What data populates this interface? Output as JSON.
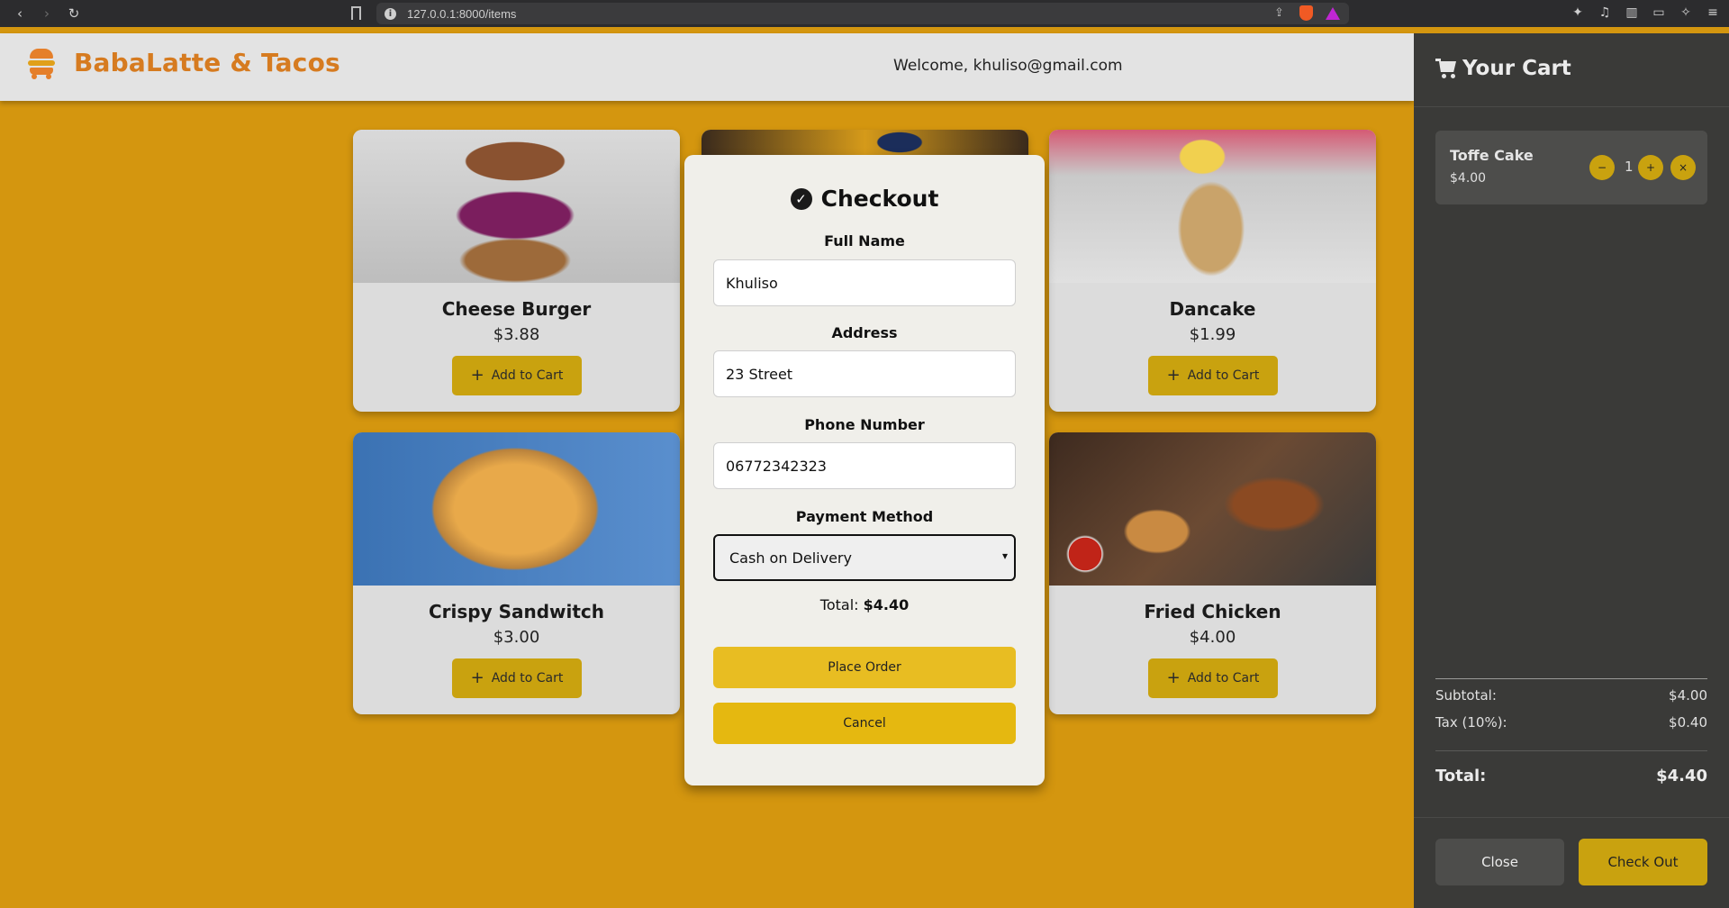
{
  "browser": {
    "url": "127.0.0.1:8000/items"
  },
  "header": {
    "brand": "BabaLatte & Tacos",
    "welcome": "Welcome, khuliso@gmail.com"
  },
  "products": [
    {
      "name": "Cheese Burger",
      "price": "$3.88",
      "button": "Add to Cart"
    },
    {
      "name": "Dancake",
      "price": "$1.99",
      "button": "Add to Cart"
    },
    {
      "name": "Crispy Sandwitch",
      "price": "$3.00",
      "button": "Add to Cart"
    },
    {
      "name": "Fried Chicken",
      "price": "$4.00",
      "button": "Add to Cart"
    }
  ],
  "checkout": {
    "title": "Checkout",
    "full_name_label": "Full Name",
    "full_name_value": "Khuliso",
    "address_label": "Address",
    "address_value": "23 Street",
    "phone_label": "Phone Number",
    "phone_value": "06772342323",
    "payment_label": "Payment Method",
    "payment_value": "Cash on Delivery",
    "total_label": "Total:",
    "total_value": "$4.40",
    "place_order": "Place Order",
    "cancel": "Cancel"
  },
  "cart": {
    "title": "Your Cart",
    "items": [
      {
        "name": "Toffe Cake",
        "price": "$4.00",
        "qty": "1",
        "minus": "−",
        "plus": "+",
        "remove": "×"
      }
    ],
    "subtotal_label": "Subtotal:",
    "subtotal_value": "$4.00",
    "tax_label": "Tax (10%):",
    "tax_value": "$0.40",
    "total_label": "Total:",
    "total_value": "$4.40",
    "close": "Close",
    "checkout": "Check Out"
  },
  "colors": {
    "page_bg": "#d4960f",
    "accent": "#c9a20f",
    "brand": "#d67b20",
    "cart_bg": "#3a3a38"
  }
}
